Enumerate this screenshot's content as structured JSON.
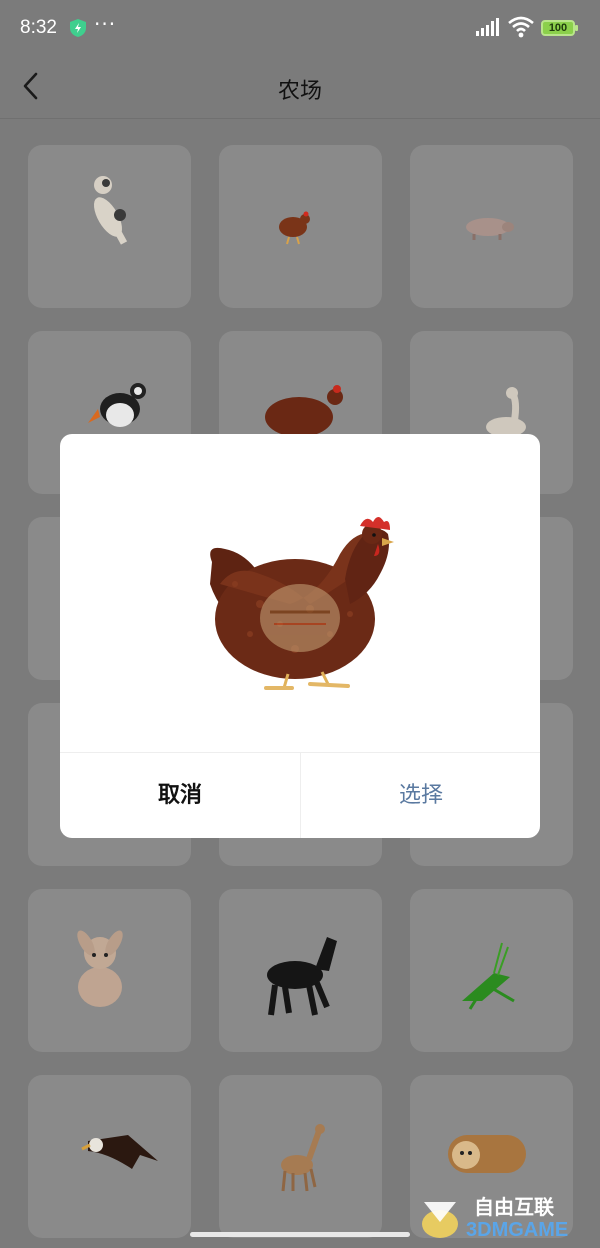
{
  "status": {
    "time": "8:32",
    "dots": "···",
    "battery": "100"
  },
  "header": {
    "title": "农场"
  },
  "grid": {
    "items": [
      {
        "icon": "dog-icon"
      },
      {
        "icon": "chicken-icon"
      },
      {
        "icon": "pig-icon"
      },
      {
        "icon": "puffin-icon"
      },
      {
        "icon": "hen-icon"
      },
      {
        "icon": "goose-icon"
      },
      {
        "icon": "animal-icon"
      },
      {
        "icon": "animal-icon"
      },
      {
        "icon": "animal-icon"
      },
      {
        "icon": "animal-icon"
      },
      {
        "icon": "animal-icon"
      },
      {
        "icon": "animal-icon"
      },
      {
        "icon": "rabbit-icon"
      },
      {
        "icon": "horse-icon"
      },
      {
        "icon": "grasshopper-icon"
      },
      {
        "icon": "eagle-icon"
      },
      {
        "icon": "deer-icon"
      },
      {
        "icon": "bread-dog-icon"
      }
    ]
  },
  "dialog": {
    "preview_icon": "hen-icon",
    "cancel_label": "取消",
    "select_label": "选择"
  },
  "watermark": {
    "text": "自由互联",
    "subtext": "3DMGAME"
  },
  "colors": {
    "overlay": "#7b7b7b",
    "select_text": "#5a79a0",
    "battery": "#8bd04b"
  }
}
